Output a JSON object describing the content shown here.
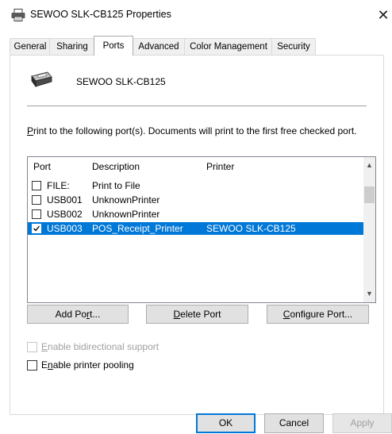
{
  "window": {
    "title": "SEWOO SLK-CB125 Properties",
    "close_glyph": "✕"
  },
  "tabs": [
    {
      "label": "General",
      "active": false
    },
    {
      "label": "Sharing",
      "active": false
    },
    {
      "label": "Ports",
      "active": true
    },
    {
      "label": "Advanced",
      "active": false
    },
    {
      "label": "Color Management",
      "active": false
    },
    {
      "label": "Security",
      "active": false
    }
  ],
  "printer": {
    "name": "SEWOO SLK-CB125",
    "icon": "printer-icon"
  },
  "description": {
    "accel": "P",
    "rest": "rint to the following port(s). Documents will print to the first free checked port."
  },
  "port_list": {
    "columns": [
      "Port",
      "Description",
      "Printer"
    ],
    "rows": [
      {
        "port": "FILE:",
        "description": "Print to File",
        "printer": "",
        "checked": false,
        "selected": false
      },
      {
        "port": "USB001",
        "description": "UnknownPrinter",
        "printer": "",
        "checked": false,
        "selected": false
      },
      {
        "port": "USB002",
        "description": "UnknownPrinter",
        "printer": "",
        "checked": false,
        "selected": false
      },
      {
        "port": "USB003",
        "description": "POS_Receipt_Printer",
        "printer": "SEWOO SLK-CB125",
        "checked": true,
        "selected": true
      }
    ]
  },
  "port_buttons": {
    "add_pre": "Add Po",
    "add_accel": "r",
    "add_post": "t...",
    "delete_accel": "D",
    "delete_post": "elete Port",
    "configure_accel": "C",
    "configure_post": "onfigure Port..."
  },
  "options": {
    "bidirectional_accel": "E",
    "bidirectional_rest": "nable bidirectional support",
    "bidirectional_enabled": false,
    "pooling_pre": "E",
    "pooling_accel": "n",
    "pooling_rest": "able printer pooling",
    "pooling_checked": false
  },
  "dialog_buttons": {
    "ok": "OK",
    "cancel": "Cancel",
    "apply": "Apply"
  },
  "colors": {
    "selection": "#0078d7",
    "default_button_border": "#0078d7"
  }
}
